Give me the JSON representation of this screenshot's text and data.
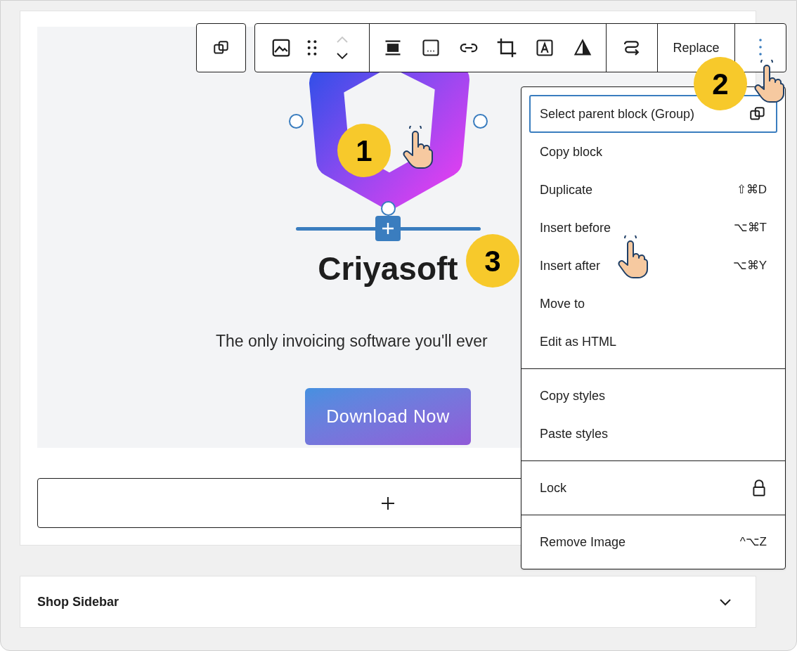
{
  "toolbar": {
    "replace_label": "Replace"
  },
  "canvas": {
    "heading": "Criyasoft",
    "text": "The only invoicing software you'll ever",
    "button": "Download Now"
  },
  "menu": {
    "sections": [
      {
        "items": [
          {
            "label": "Select parent block (Group)",
            "kind": "parent",
            "selected": true
          },
          {
            "label": "Copy block",
            "kind": "plain",
            "selected": false
          },
          {
            "label": "Duplicate",
            "kind": "shortcut",
            "shortcut": "⇧⌘D",
            "selected": false
          },
          {
            "label": "Insert before",
            "kind": "shortcut",
            "shortcut": "⌥⌘T",
            "selected": false
          },
          {
            "label": "Insert after",
            "kind": "shortcut",
            "shortcut": "⌥⌘Y",
            "selected": false
          },
          {
            "label": "Move to",
            "kind": "plain",
            "selected": false
          },
          {
            "label": "Edit as HTML",
            "kind": "plain",
            "selected": false
          }
        ]
      },
      {
        "items": [
          {
            "label": "Copy styles",
            "kind": "plain",
            "selected": false
          },
          {
            "label": "Paste styles",
            "kind": "plain",
            "selected": false
          }
        ]
      },
      {
        "items": [
          {
            "label": "Lock",
            "kind": "lock",
            "selected": false
          }
        ]
      },
      {
        "items": [
          {
            "label": "Remove Image",
            "kind": "shortcut",
            "shortcut": "^⌥Z",
            "selected": false
          }
        ]
      }
    ]
  },
  "badges": [
    "1",
    "2",
    "3"
  ],
  "sidebar_panel": {
    "title": "Shop Sidebar",
    "expanded": false
  }
}
